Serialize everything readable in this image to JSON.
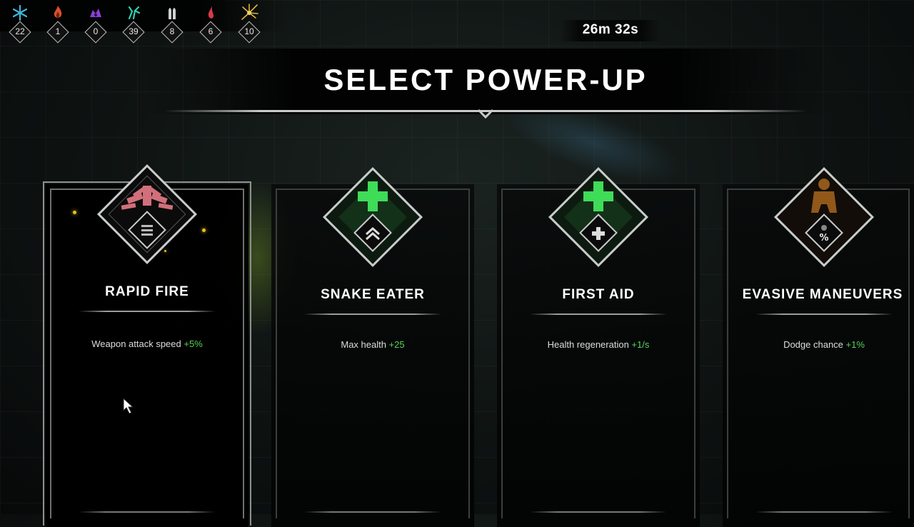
{
  "resources": [
    {
      "icon": "frost-icon",
      "count": "22",
      "color": "#3fb6d8"
    },
    {
      "icon": "flame-icon",
      "count": "1",
      "color": "#d8512e"
    },
    {
      "icon": "void-icon",
      "count": "0",
      "color": "#8a3fd8"
    },
    {
      "icon": "toxic-icon",
      "count": "39",
      "color": "#2fd2b0"
    },
    {
      "icon": "bullet-icon",
      "count": "8",
      "color": "#d0d0d0"
    },
    {
      "icon": "blood-icon",
      "count": "6",
      "color": "#d83a4a"
    },
    {
      "icon": "lightning-icon",
      "count": "10",
      "color": "#e0b43a"
    }
  ],
  "timer": "26m 32s",
  "title": "SELECT POWER-UP",
  "cards": [
    {
      "name": "RAPID FIRE",
      "stat": "Weapon attack speed",
      "bonus": "+5%",
      "emblem_color": "#d1707a",
      "sub_icon": "ammo-icon",
      "selected": true
    },
    {
      "name": "SNAKE EATER",
      "stat": "Max health",
      "bonus": "+25",
      "emblem_color": "#3fdc58",
      "sub_icon": "chevron-up-icon",
      "selected": false
    },
    {
      "name": "FIRST AID",
      "stat": "Health regeneration",
      "bonus": "+1/s",
      "emblem_color": "#3fdc58",
      "sub_icon": "plus-icon",
      "selected": false
    },
    {
      "name": "EVASIVE MANEUVERS",
      "stat": "Dodge chance",
      "bonus": "+1%",
      "emblem_color": "#a8661e",
      "sub_icon": "percent-icon",
      "selected": false
    }
  ],
  "colors": {
    "bonus": "#58d25a",
    "frame": "#8d9290"
  }
}
